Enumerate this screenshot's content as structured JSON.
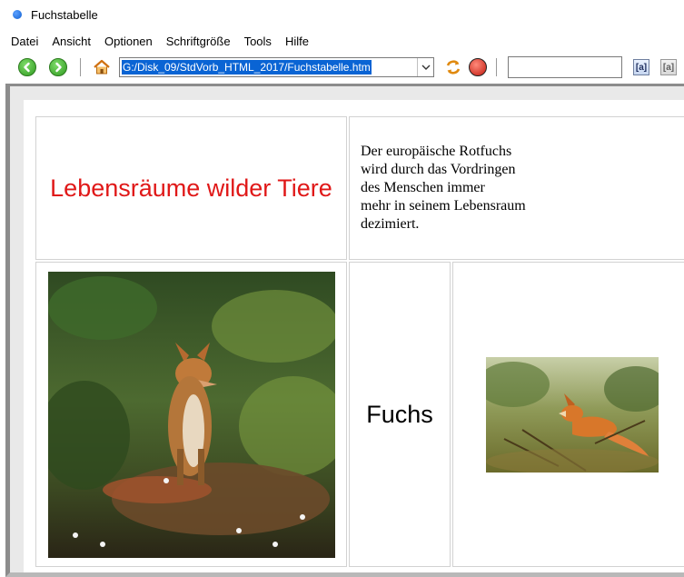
{
  "window": {
    "title": "Fuchstabelle"
  },
  "menu": [
    "Datei",
    "Ansicht",
    "Optionen",
    "Schriftgröße",
    "Tools",
    "Hilfe"
  ],
  "toolbar": {
    "back_icon": "back-arrow-icon",
    "forward_icon": "forward-arrow-icon",
    "home_icon": "home-icon",
    "url": "G:/Disk_09/StdVorb_HTML_2017/Fuchstabelle.htm",
    "refresh_icon": "refresh-icon",
    "stop_icon": "stop-icon",
    "search_value": "",
    "find_button": "[a]",
    "find_button2": "[a]"
  },
  "content": {
    "heading": "Lebensräume wilder Tiere",
    "description": "Der europäische Rotfuchs\nwird durch das Vordringen\ndes Menschen immer\nmehr in seinem Lebensraum\ndezimiert.",
    "label": "Fuchs",
    "heading_color": "#e01818"
  }
}
